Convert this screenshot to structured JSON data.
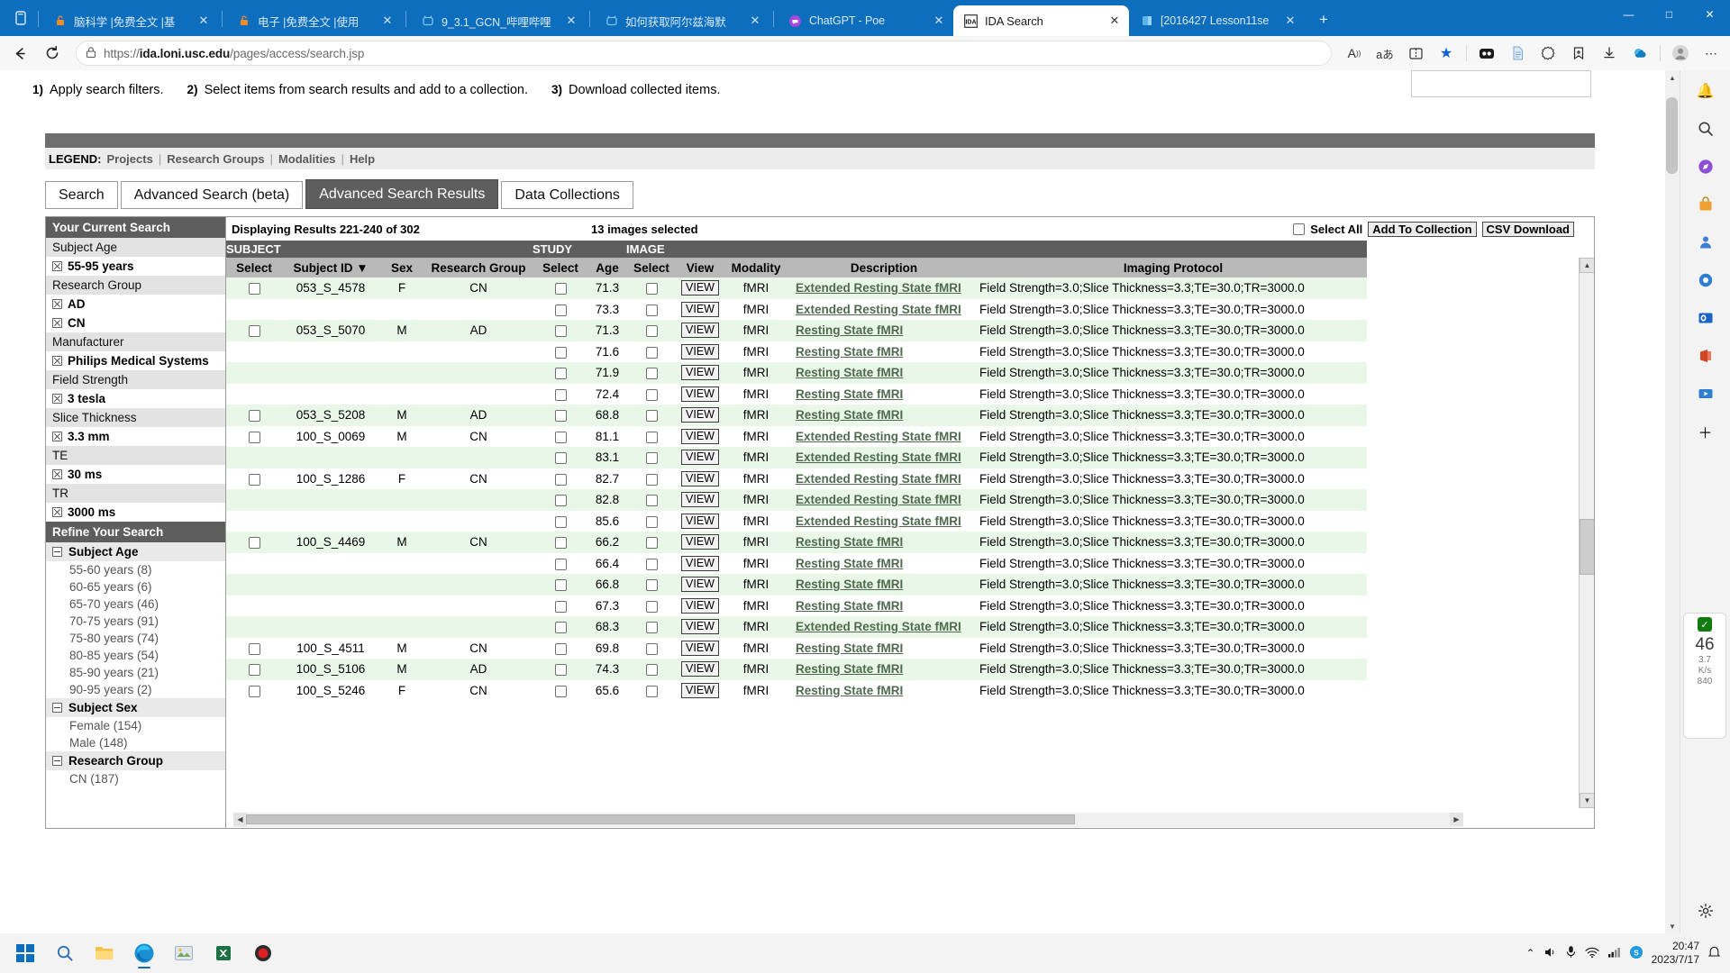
{
  "browser": {
    "tabs": [
      {
        "title": "脑科学 |免费全文 |基",
        "favicon": "lock-orange-icon",
        "active": false
      },
      {
        "title": "电子 |免费全文 |使用",
        "favicon": "lock-orange-icon",
        "active": false
      },
      {
        "title": "9_3.1_GCN_哔哩哔哩",
        "favicon": "bilibili-icon",
        "active": false
      },
      {
        "title": "如何获取阿尔兹海默",
        "favicon": "bilibili-icon",
        "active": false
      },
      {
        "title": "ChatGPT - Poe",
        "favicon": "poe-icon",
        "active": false
      },
      {
        "title": "IDA Search",
        "favicon": "ida-icon",
        "active": true
      },
      {
        "title": "[2016427 Lesson11se",
        "favicon": "onenote-icon",
        "active": false
      }
    ],
    "new_tab_label": "+",
    "window_controls": {
      "minimize": "—",
      "maximize": "□",
      "close": "✕"
    },
    "nav": {
      "back": "←",
      "reload": "⟳",
      "lock": "🔒",
      "url_prefix": "https://",
      "url_host": "ida.loni.usc.edu",
      "url_path": "/pages/access/search.jsp",
      "icons": [
        "read-aloud-icon",
        "translate-icon",
        "split-screen-icon",
        "favorite-star-icon",
        "collections-icon",
        "reading-list-icon",
        "browser-essentials-icon",
        "add-to-favorites-icon",
        "downloads-icon",
        "copilot-icon",
        "profile-icon",
        "settings-more-icon"
      ]
    }
  },
  "page": {
    "steps": [
      {
        "num": "1)",
        "text": "Apply search filters."
      },
      {
        "num": "2)",
        "text": "Select items from search results and add to a collection."
      },
      {
        "num": "3)",
        "text": "Download collected items."
      }
    ],
    "legend": {
      "label": "LEGEND:",
      "links": [
        "Projects",
        "Research Groups",
        "Modalities",
        "Help"
      ],
      "separator": "|"
    },
    "tabs": [
      {
        "label": "Search",
        "selected": false
      },
      {
        "label": "Advanced Search (beta)",
        "selected": false
      },
      {
        "label": "Advanced Search Results",
        "selected": true
      },
      {
        "label": "Data Collections",
        "selected": false
      }
    ],
    "sidebar": {
      "current_search_title": "Your Current Search",
      "current_search": [
        {
          "type": "cat",
          "label": "Subject Age"
        },
        {
          "type": "val",
          "label": "55-95 years"
        },
        {
          "type": "cat",
          "label": "Research Group"
        },
        {
          "type": "val",
          "label": "AD"
        },
        {
          "type": "val",
          "label": "CN"
        },
        {
          "type": "cat",
          "label": "Manufacturer"
        },
        {
          "type": "val",
          "label": "Philips Medical Systems"
        },
        {
          "type": "cat",
          "label": "Field Strength"
        },
        {
          "type": "val",
          "label": "3 tesla"
        },
        {
          "type": "cat",
          "label": "Slice Thickness"
        },
        {
          "type": "val",
          "label": "3.3 mm"
        },
        {
          "type": "cat",
          "label": "TE"
        },
        {
          "type": "val",
          "label": "30 ms"
        },
        {
          "type": "cat",
          "label": "TR"
        },
        {
          "type": "val",
          "label": "3000 ms"
        }
      ],
      "refine_title": "Refine Your Search",
      "refine": [
        {
          "type": "group",
          "label": "Subject Age"
        },
        {
          "type": "item",
          "label": "55-60 years (8)"
        },
        {
          "type": "item",
          "label": "60-65 years (6)"
        },
        {
          "type": "item",
          "label": "65-70 years (46)"
        },
        {
          "type": "item",
          "label": "70-75 years (91)"
        },
        {
          "type": "item",
          "label": "75-80 years (74)"
        },
        {
          "type": "item",
          "label": "80-85 years (54)"
        },
        {
          "type": "item",
          "label": "85-90 years (21)"
        },
        {
          "type": "item",
          "label": "90-95 years (2)"
        },
        {
          "type": "group",
          "label": "Subject Sex"
        },
        {
          "type": "item",
          "label": "Female (154)"
        },
        {
          "type": "item",
          "label": "Male (148)"
        },
        {
          "type": "group",
          "label": "Research Group"
        },
        {
          "type": "item",
          "label": "CN (187)"
        }
      ]
    },
    "results": {
      "displaying": "Displaying Results 221-240 of 302",
      "selected_count": "13 images selected",
      "select_all_label": "Select All",
      "add_to_collection_label": "Add To Collection",
      "csv_download_label": "CSV Download",
      "group_headers": [
        "SUBJECT",
        "STUDY",
        "IMAGE"
      ],
      "columns": [
        "Select",
        "Subject ID ▼",
        "Sex",
        "Research Group",
        "Select",
        "Age",
        "Select",
        "View",
        "Modality",
        "Description",
        "Imaging Protocol"
      ],
      "view_label": "VIEW",
      "rows": [
        {
          "subject_id": "053_S_4578",
          "sex": "F",
          "group": "CN",
          "age": "71.3",
          "modality": "fMRI",
          "description": "Extended Resting State fMRI",
          "protocol": "Field Strength=3.0;Slice Thickness=3.3;TE=30.0;TR=3000.0",
          "shade": "even"
        },
        {
          "subject_id": "",
          "sex": "",
          "group": "",
          "age": "73.3",
          "modality": "fMRI",
          "description": "Extended Resting State fMRI",
          "protocol": "Field Strength=3.0;Slice Thickness=3.3;TE=30.0;TR=3000.0",
          "shade": "odd"
        },
        {
          "subject_id": "053_S_5070",
          "sex": "M",
          "group": "AD",
          "age": "71.3",
          "modality": "fMRI",
          "description": "Resting State fMRI",
          "protocol": "Field Strength=3.0;Slice Thickness=3.3;TE=30.0;TR=3000.0",
          "shade": "even"
        },
        {
          "subject_id": "",
          "sex": "",
          "group": "",
          "age": "71.6",
          "modality": "fMRI",
          "description": "Resting State fMRI",
          "protocol": "Field Strength=3.0;Slice Thickness=3.3;TE=30.0;TR=3000.0",
          "shade": "odd"
        },
        {
          "subject_id": "",
          "sex": "",
          "group": "",
          "age": "71.9",
          "modality": "fMRI",
          "description": "Resting State fMRI",
          "protocol": "Field Strength=3.0;Slice Thickness=3.3;TE=30.0;TR=3000.0",
          "shade": "even"
        },
        {
          "subject_id": "",
          "sex": "",
          "group": "",
          "age": "72.4",
          "modality": "fMRI",
          "description": "Resting State fMRI",
          "protocol": "Field Strength=3.0;Slice Thickness=3.3;TE=30.0;TR=3000.0",
          "shade": "odd"
        },
        {
          "subject_id": "053_S_5208",
          "sex": "M",
          "group": "AD",
          "age": "68.8",
          "modality": "fMRI",
          "description": "Resting State fMRI",
          "protocol": "Field Strength=3.0;Slice Thickness=3.3;TE=30.0;TR=3000.0",
          "shade": "even"
        },
        {
          "subject_id": "100_S_0069",
          "sex": "M",
          "group": "CN",
          "age": "81.1",
          "modality": "fMRI",
          "description": "Extended Resting State fMRI",
          "protocol": "Field Strength=3.0;Slice Thickness=3.3;TE=30.0;TR=3000.0",
          "shade": "odd"
        },
        {
          "subject_id": "",
          "sex": "",
          "group": "",
          "age": "83.1",
          "modality": "fMRI",
          "description": "Extended Resting State fMRI",
          "protocol": "Field Strength=3.0;Slice Thickness=3.3;TE=30.0;TR=3000.0",
          "shade": "even"
        },
        {
          "subject_id": "100_S_1286",
          "sex": "F",
          "group": "CN",
          "age": "82.7",
          "modality": "fMRI",
          "description": "Extended Resting State fMRI",
          "protocol": "Field Strength=3.0;Slice Thickness=3.3;TE=30.0;TR=3000.0",
          "shade": "odd"
        },
        {
          "subject_id": "",
          "sex": "",
          "group": "",
          "age": "82.8",
          "modality": "fMRI",
          "description": "Extended Resting State fMRI",
          "protocol": "Field Strength=3.0;Slice Thickness=3.3;TE=30.0;TR=3000.0",
          "shade": "even"
        },
        {
          "subject_id": "",
          "sex": "",
          "group": "",
          "age": "85.6",
          "modality": "fMRI",
          "description": "Extended Resting State fMRI",
          "protocol": "Field Strength=3.0;Slice Thickness=3.3;TE=30.0;TR=3000.0",
          "shade": "odd"
        },
        {
          "subject_id": "100_S_4469",
          "sex": "M",
          "group": "CN",
          "age": "66.2",
          "modality": "fMRI",
          "description": "Resting State fMRI",
          "protocol": "Field Strength=3.0;Slice Thickness=3.3;TE=30.0;TR=3000.0",
          "shade": "even"
        },
        {
          "subject_id": "",
          "sex": "",
          "group": "",
          "age": "66.4",
          "modality": "fMRI",
          "description": "Resting State fMRI",
          "protocol": "Field Strength=3.0;Slice Thickness=3.3;TE=30.0;TR=3000.0",
          "shade": "odd"
        },
        {
          "subject_id": "",
          "sex": "",
          "group": "",
          "age": "66.8",
          "modality": "fMRI",
          "description": "Resting State fMRI",
          "protocol": "Field Strength=3.0;Slice Thickness=3.3;TE=30.0;TR=3000.0",
          "shade": "even"
        },
        {
          "subject_id": "",
          "sex": "",
          "group": "",
          "age": "67.3",
          "modality": "fMRI",
          "description": "Resting State fMRI",
          "protocol": "Field Strength=3.0;Slice Thickness=3.3;TE=30.0;TR=3000.0",
          "shade": "odd"
        },
        {
          "subject_id": "",
          "sex": "",
          "group": "",
          "age": "68.3",
          "modality": "fMRI",
          "description": "Extended Resting State fMRI",
          "protocol": "Field Strength=3.0;Slice Thickness=3.3;TE=30.0;TR=3000.0",
          "shade": "even"
        },
        {
          "subject_id": "100_S_4511",
          "sex": "M",
          "group": "CN",
          "age": "69.8",
          "modality": "fMRI",
          "description": "Resting State fMRI",
          "protocol": "Field Strength=3.0;Slice Thickness=3.3;TE=30.0;TR=3000.0",
          "shade": "odd"
        },
        {
          "subject_id": "100_S_5106",
          "sex": "M",
          "group": "AD",
          "age": "74.3",
          "modality": "fMRI",
          "description": "Resting State fMRI",
          "protocol": "Field Strength=3.0;Slice Thickness=3.3;TE=30.0;TR=3000.0",
          "shade": "even"
        },
        {
          "subject_id": "100_S_5246",
          "sex": "F",
          "group": "CN",
          "age": "65.6",
          "modality": "fMRI",
          "description": "Resting State fMRI",
          "protocol": "Field Strength=3.0;Slice Thickness=3.3;TE=30.0;TR=3000.0",
          "shade": "odd"
        }
      ]
    }
  },
  "copilot_card": {
    "check": "✓",
    "score": "46",
    "line1": "3.7",
    "line2": "K/s",
    "line3": "840"
  },
  "taskbar": {
    "start": "start-icon",
    "apps": [
      "search-icon",
      "file-explorer-icon",
      "edge-icon",
      "app-icon",
      "excel-icon",
      "record-icon"
    ],
    "tray": [
      "chevron-up-icon",
      "sound-icon",
      "mic-icon",
      "wifi-icon",
      "network-icon",
      "skype-icon"
    ],
    "time": "20:47",
    "date": "2023/7/17",
    "notification": "notification-icon"
  }
}
